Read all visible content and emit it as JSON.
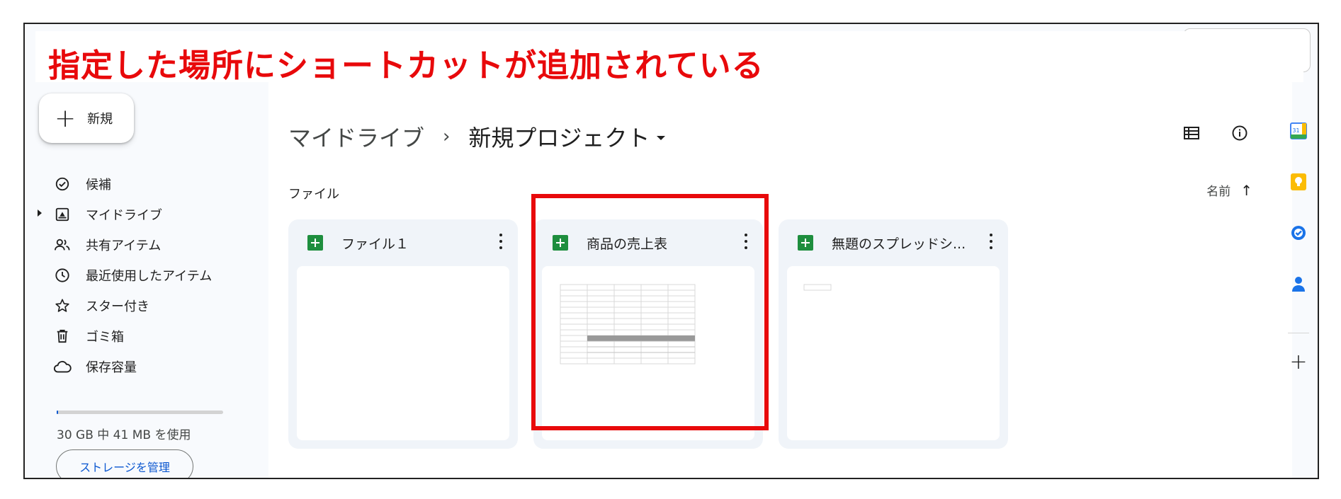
{
  "annotation": {
    "text": "指定した場所にショートカットが追加されている",
    "color": "#e8090b"
  },
  "sidebar": {
    "new_label": "新規",
    "items": [
      {
        "label": "候補",
        "icon": "check-circle-icon"
      },
      {
        "label": "マイドライブ",
        "icon": "my-drive-icon"
      },
      {
        "label": "共有アイテム",
        "icon": "people-icon"
      },
      {
        "label": "最近使用したアイテム",
        "icon": "clock-icon"
      },
      {
        "label": "スター付き",
        "icon": "star-icon"
      },
      {
        "label": "ゴミ箱",
        "icon": "trash-icon"
      },
      {
        "label": "保存容量",
        "icon": "cloud-icon"
      }
    ],
    "storage_text": "30 GB 中 41 MB を使用",
    "storage_used_fraction": 0.01,
    "manage_label": "ストレージを管理"
  },
  "breadcrumb": {
    "root": "マイドライブ",
    "separator": "›",
    "current": "新規プロジェクト"
  },
  "main": {
    "section_label": "ファイル",
    "sort_label": "名前",
    "sort_arrow": "↑",
    "files": [
      {
        "name": "ファイル１",
        "type": "spreadsheet"
      },
      {
        "name": "商品の売上表",
        "type": "spreadsheet"
      },
      {
        "name": "無題のスプレッドシ...",
        "type": "spreadsheet"
      }
    ]
  },
  "rail": {
    "icons": [
      "calendar-icon",
      "keep-icon",
      "tasks-icon",
      "contacts-icon",
      "add-icon"
    ],
    "calendar_day": "31",
    "add_symbol": "+"
  },
  "colors": {
    "accent": "#0b57d0",
    "sheets_green": "#1e8e3e",
    "highlight": "#e8090b"
  }
}
